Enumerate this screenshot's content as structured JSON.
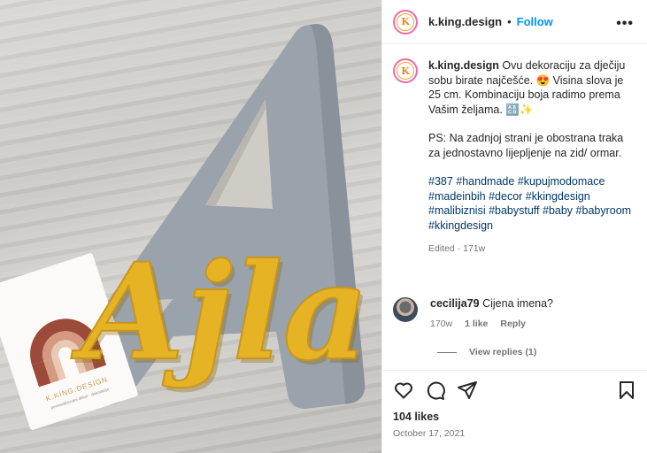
{
  "header": {
    "username": "k.king.design",
    "dot": "•",
    "follow_label": "Follow",
    "more_label": "•••",
    "avatar_letter": "K"
  },
  "caption": {
    "username": "k.king.design",
    "body": "Ovu dekoraciju za dječiju sobu birate najčešće. 😍 Visina slova je 25 cm. Kombinaciju boja radimo prema Vašim željama. 🔠✨",
    "ps": "PS: Na zadnjoj strani je obostrana traka za jednostavno lijepljenje na zid/ ormar.",
    "hashtags": "#387 #handmade #kupujmodomace #madeinbih #decor #kkingdesign #malibiznisi #babystuff #baby #babyroom #kkingdesign",
    "meta": "Edited · 171w"
  },
  "comment": {
    "username": "cecilija79",
    "text": "Cijena imena?",
    "time": "170w",
    "likes": "1 like",
    "reply": "Reply"
  },
  "view_replies": "View replies (1)",
  "likes": "104 likes",
  "date": "October 17, 2021",
  "photo": {
    "word": "Ajla",
    "card_brand": "K.KING.DESIGN",
    "card_tagline": "personalizovani dekor · dekoracije",
    "colors": {
      "letter": "#9aa2ab",
      "word": "#e6b325",
      "rainbow_outer": "#9c4a3a",
      "rainbow_mid": "#d49a80",
      "rainbow_inner": "#e9c9b4"
    }
  },
  "icons": [
    "heart-icon",
    "comment-icon",
    "share-icon",
    "bookmark-icon"
  ]
}
